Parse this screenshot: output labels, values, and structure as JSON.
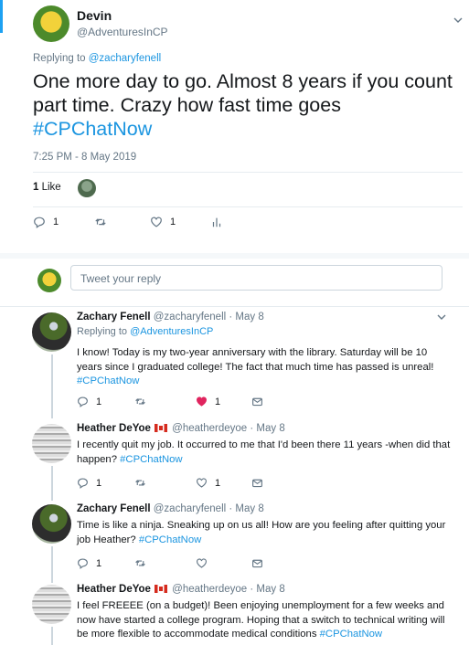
{
  "main_tweet": {
    "author_name": "Devin",
    "author_handle": "@AdventuresInCP",
    "replying_prefix": "Replying to",
    "replying_to": "@zacharyfenell",
    "text": "One more day to go. Almost 8 years if you count part time. Crazy how fast time goes",
    "hashtag": "#CPChatNow",
    "timestamp": "7:25 PM - 8 May 2019",
    "likes_count": "1",
    "likes_label": "Like",
    "reply_count": "1",
    "like_count": "1"
  },
  "reply_box": {
    "placeholder": "Tweet your reply"
  },
  "replies": [
    {
      "name": "Zachary Fenell",
      "handle": "@zacharyfenell",
      "date": "· May 8",
      "replying_prefix": "Replying to",
      "replying_to": "@AdventuresInCP",
      "text": "I know! Today is my two-year anniversary with the library. Saturday will be 10 years since I graduated college! The fact that much time has passed is unreal!",
      "hashtag": "#CPChatNow",
      "reply_count": "1",
      "like_count": "1",
      "liked": true
    },
    {
      "name": "Heather DeYoe",
      "handle": "@heatherdeyoe",
      "date": "· May 8",
      "text": "I recently quit my job. It occurred to me that I'd been there 11 years -when did that happen?",
      "hashtag": "#CPChatNow",
      "reply_count": "1",
      "like_count": "1"
    },
    {
      "name": "Zachary Fenell",
      "handle": "@zacharyfenell",
      "date": "· May 8",
      "text": "Time is like a ninja. Sneaking up on us all! How are you feeling after quitting your job Heather?",
      "hashtag": "#CPChatNow",
      "reply_count": "1"
    },
    {
      "name": "Heather DeYoe",
      "handle": "@heatherdeyoe",
      "date": "· May 8",
      "text": "I feel FREEEE (on a budget)! Been enjoying unemployment for a few weeks and now have started a college program. Hoping that a switch to technical writing will be more flexible to accommodate medical conditions",
      "hashtag": "#CPChatNow"
    }
  ],
  "icons": {
    "reply": "reply-icon",
    "retweet": "retweet-icon",
    "like": "heart-icon",
    "analytics": "analytics-icon",
    "message": "envelope-icon",
    "caret": "chevron-down-icon",
    "flag": "canada-flag-icon"
  },
  "colors": {
    "link": "#1b95e0",
    "like_active": "#e0245e",
    "muted": "#657786"
  }
}
